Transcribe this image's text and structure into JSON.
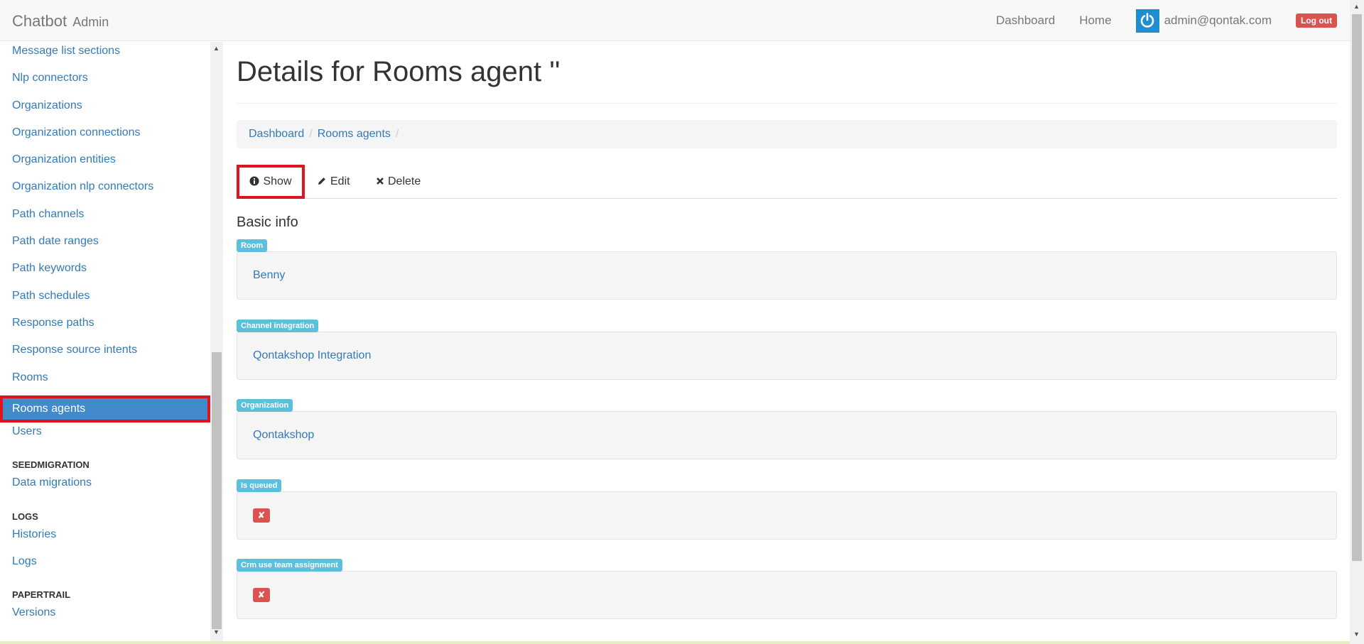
{
  "navbar": {
    "brand": "Chatbot",
    "brand_sub": "Admin",
    "links": [
      "Dashboard",
      "Home"
    ],
    "user_email": "admin@qontak.com",
    "logout_label": "Log out"
  },
  "sidebar": {
    "items_top": [
      "Message list sections",
      "Nlp connectors",
      "Organizations",
      "Organization connections",
      "Organization entities",
      "Organization nlp connectors",
      "Path channels",
      "Path date ranges",
      "Path keywords",
      "Path schedules",
      "Response paths",
      "Response source intents",
      "Rooms"
    ],
    "active_item": "Rooms agents",
    "item_users": "Users",
    "section_seedmigration": "SEEDMIGRATION",
    "item_data_migrations": "Data migrations",
    "section_logs": "LOGS",
    "item_histories": "Histories",
    "item_logs": "Logs",
    "section_papertrail": "PAPERTRAIL",
    "item_versions": "Versions"
  },
  "main": {
    "title": "Details for Rooms agent ''",
    "breadcrumb": [
      "Dashboard",
      "Rooms agents"
    ],
    "breadcrumb_sep": "/",
    "tabs": {
      "show": "Show",
      "edit": "Edit",
      "delete": "Delete"
    },
    "section_title": "Basic info",
    "fields": {
      "room": {
        "label": "Room",
        "value": "Benny"
      },
      "channel_integration": {
        "label": "Channel integration",
        "value": "Qontakshop Integration"
      },
      "organization": {
        "label": "Organization",
        "value": "Qontakshop"
      },
      "is_queued": {
        "label": "Is queued",
        "value": "✘"
      },
      "crm_use_team_assignment": {
        "label": "Crm use team assignment",
        "value": "✘"
      }
    }
  },
  "icons": {
    "show": "info-circle-icon",
    "edit": "pencil-icon",
    "delete": "times-icon",
    "user": "power-icon"
  },
  "colors": {
    "link": "#337ab7",
    "active": "#428bca",
    "highlight": "#e1141e",
    "label": "#5bc0de",
    "danger": "#d9534f"
  }
}
